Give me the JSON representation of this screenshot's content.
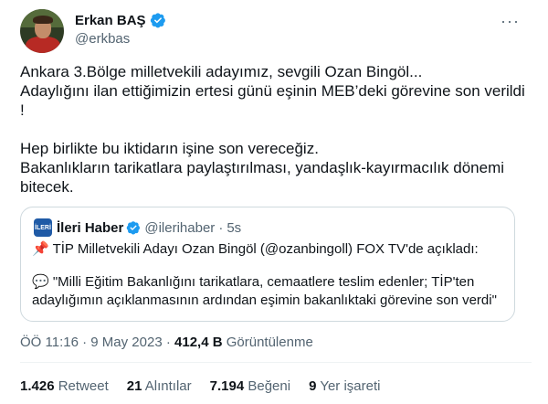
{
  "author": {
    "name": "Erkan BAŞ",
    "handle": "@erkbas"
  },
  "tweet": {
    "para1": "Ankara 3.Bölge milletvekili adayımız, sevgili Ozan Bingöl...\nAdaylığını ilan ettiğimizin ertesi günü eşinin MEB’deki görevine son verildi\n!",
    "para2": "Hep birlikte bu iktidarın işine son vereceğiz.\nBakanlıkların tarikatlara paylaştırılması, yandaşlık-kayırmacılık dönemi\nbitecek."
  },
  "quote": {
    "logo_text": "İLERİ",
    "name": "İleri Haber",
    "handle": "@ilerihaber",
    "separator": "·",
    "time": "5s",
    "line1_icon": "📌",
    "line1": "TİP Milletvekili Adayı Ozan Bingöl (@ozanbingoll) FOX TV'de açıkladı:",
    "line2_icon": "💬",
    "line2": "\"Milli Eğitim Bakanlığını tarikatlara, cemaatlere teslim edenler; TİP'ten adaylığımın açıklanmasının ardından eşimin bakanlıktaki görevine son verdi\""
  },
  "meta": {
    "time": "ÖÖ 11:16",
    "dot": "·",
    "date": "9 May 2023",
    "views_count": "412,4 B",
    "views_label": "Görüntülenme"
  },
  "stats": {
    "retweet_count": "1.426",
    "retweet_label": "Retweet",
    "quotes_count": "21",
    "quotes_label": "Alıntılar",
    "likes_count": "7.194",
    "likes_label": "Beğeni",
    "bookmarks_count": "9",
    "bookmarks_label": "Yer işareti"
  },
  "more_glyph": "···",
  "colors": {
    "verified": "#1d9bf0",
    "secondary": "#536471",
    "border": "#cfd9de"
  }
}
